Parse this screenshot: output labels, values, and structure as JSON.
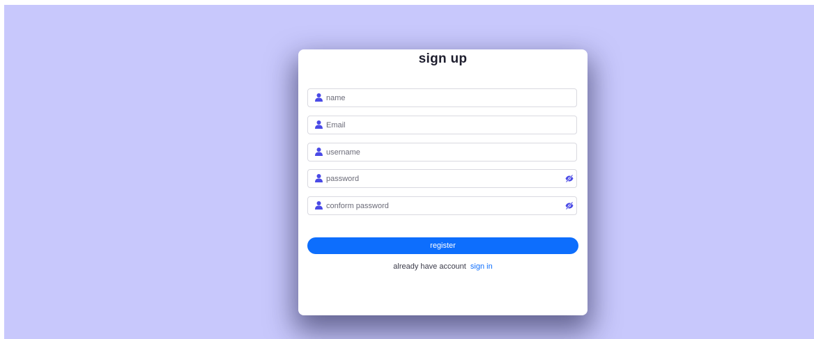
{
  "form": {
    "title": "sign up",
    "fields": {
      "name": {
        "placeholder": "name",
        "value": "",
        "icon": "user-icon"
      },
      "email": {
        "placeholder": "Email",
        "value": "",
        "icon": "user-icon"
      },
      "username": {
        "placeholder": "username",
        "value": "",
        "icon": "user-icon"
      },
      "password": {
        "placeholder": "password",
        "value": "",
        "icon": "user-icon",
        "toggle_icon": "eye-slash-icon"
      },
      "confirm_password": {
        "placeholder": "conform password",
        "value": "",
        "icon": "user-icon",
        "toggle_icon": "eye-slash-icon"
      }
    },
    "register_label": "register",
    "signin_prompt": "already have account",
    "signin_link": "sign in"
  },
  "colors": {
    "background": "#c8c8fc",
    "accent": "#0d6efd",
    "icon": "#4a4ae6"
  }
}
